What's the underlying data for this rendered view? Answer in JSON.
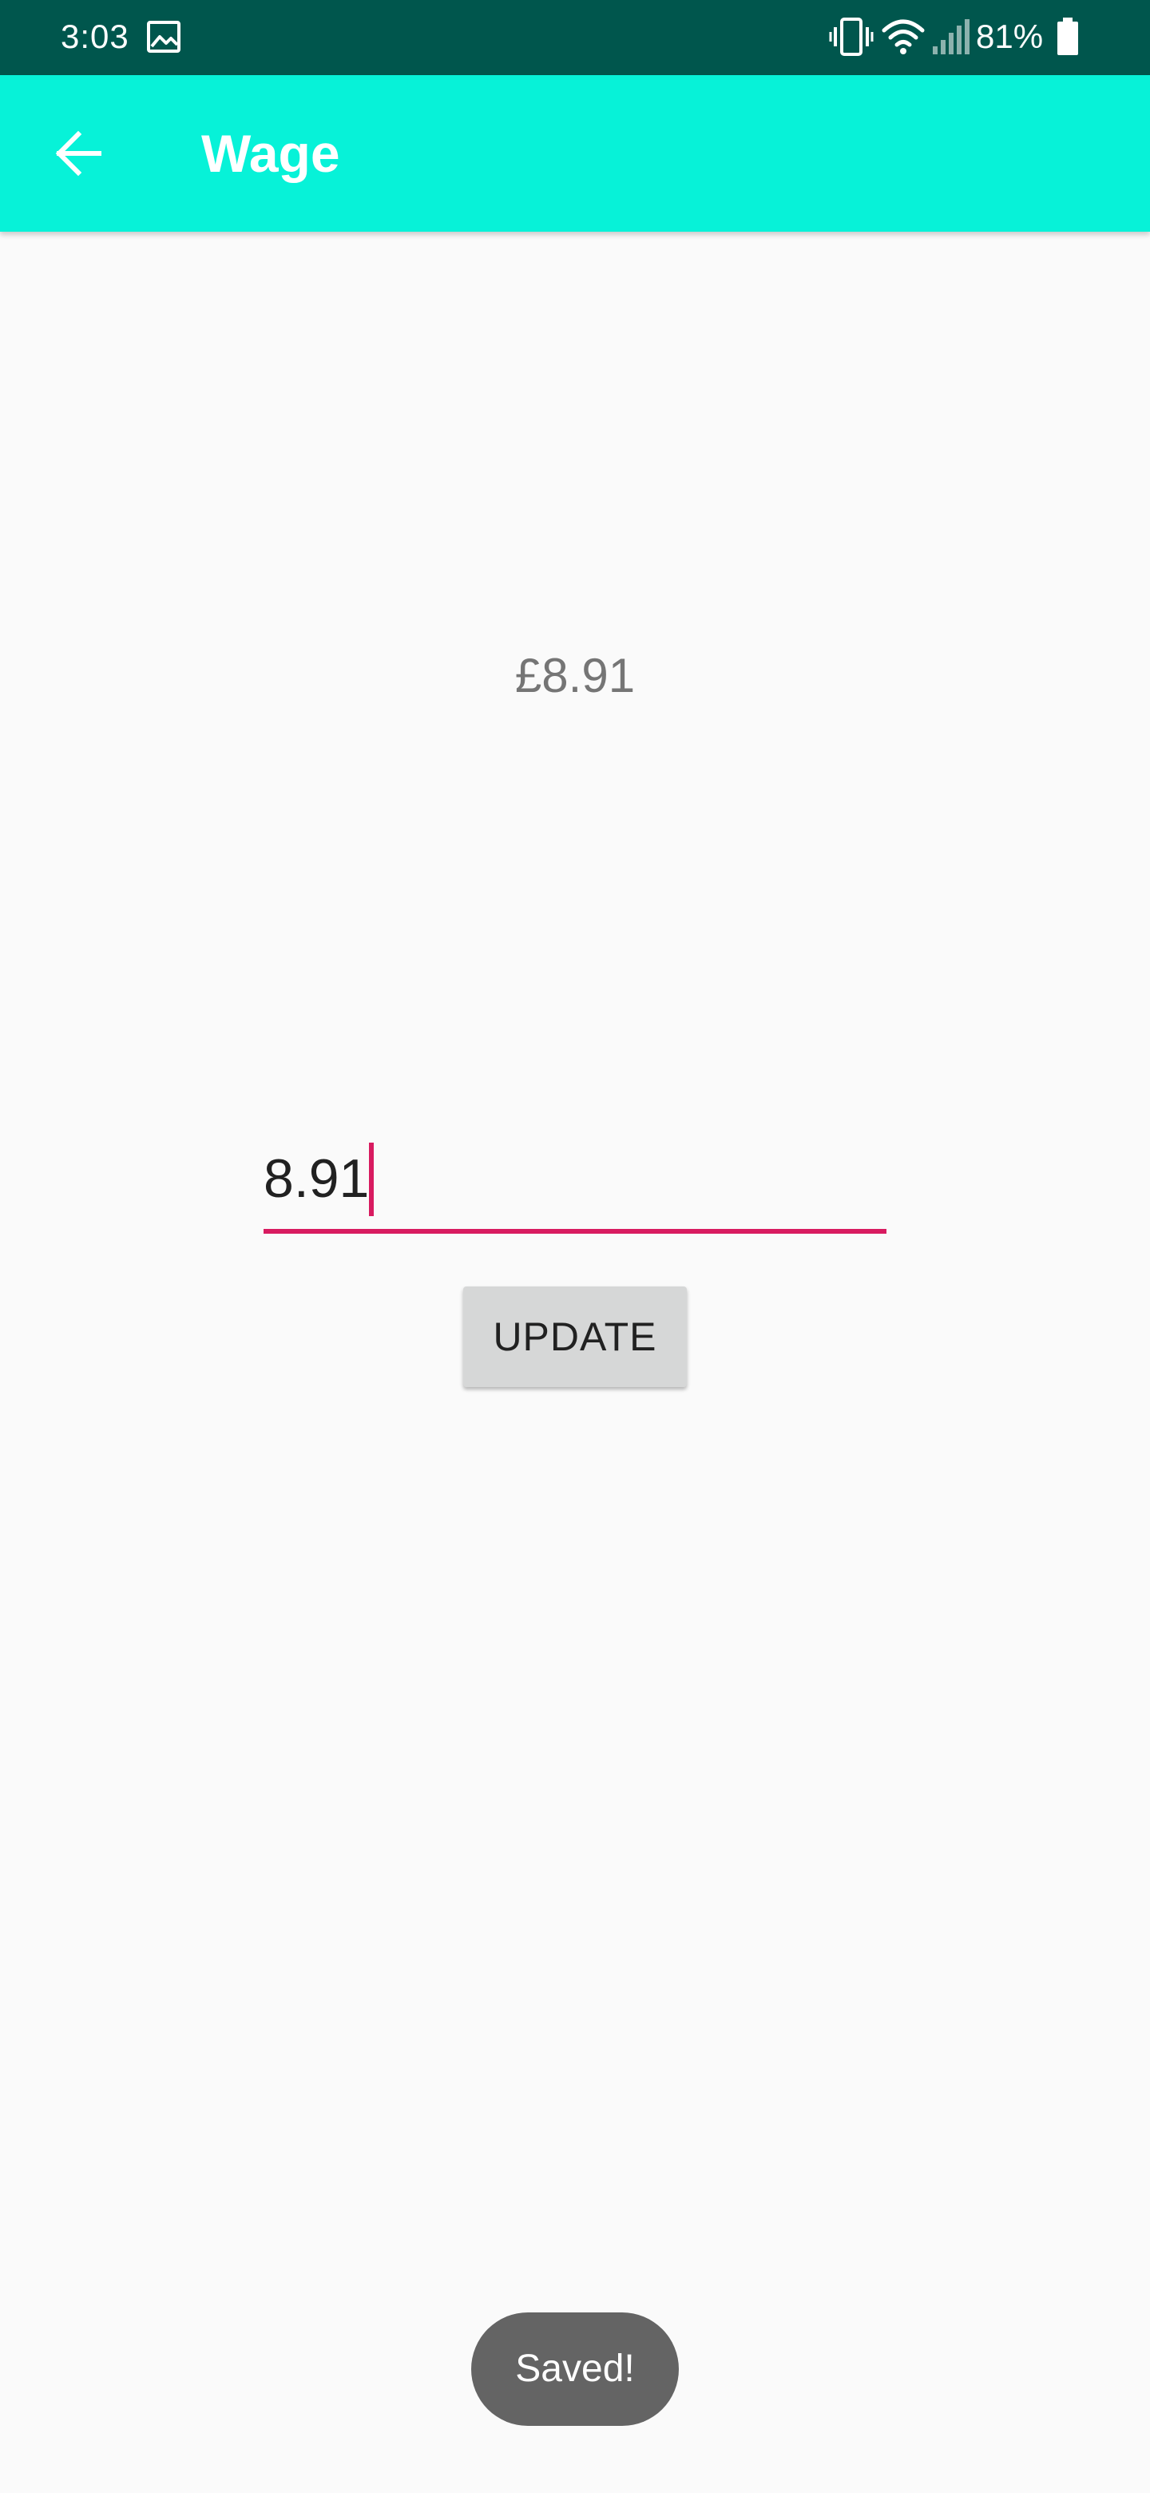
{
  "status_bar": {
    "time": "3:03",
    "battery_percent": "81%",
    "background_color": "#00564d",
    "icons": [
      "gallery-icon",
      "vibrate-icon",
      "wifi-icon",
      "signal-icon",
      "battery-icon"
    ]
  },
  "app_bar": {
    "title": "Wage",
    "background_color": "#07f2d8",
    "back_icon": "arrow-back-icon"
  },
  "main": {
    "wage_display": "£8.91",
    "wage_input": {
      "value": "8.91",
      "underline_color": "#d81b60"
    },
    "update_button_label": "UPDATE"
  },
  "toast": {
    "message": "Saved!"
  }
}
